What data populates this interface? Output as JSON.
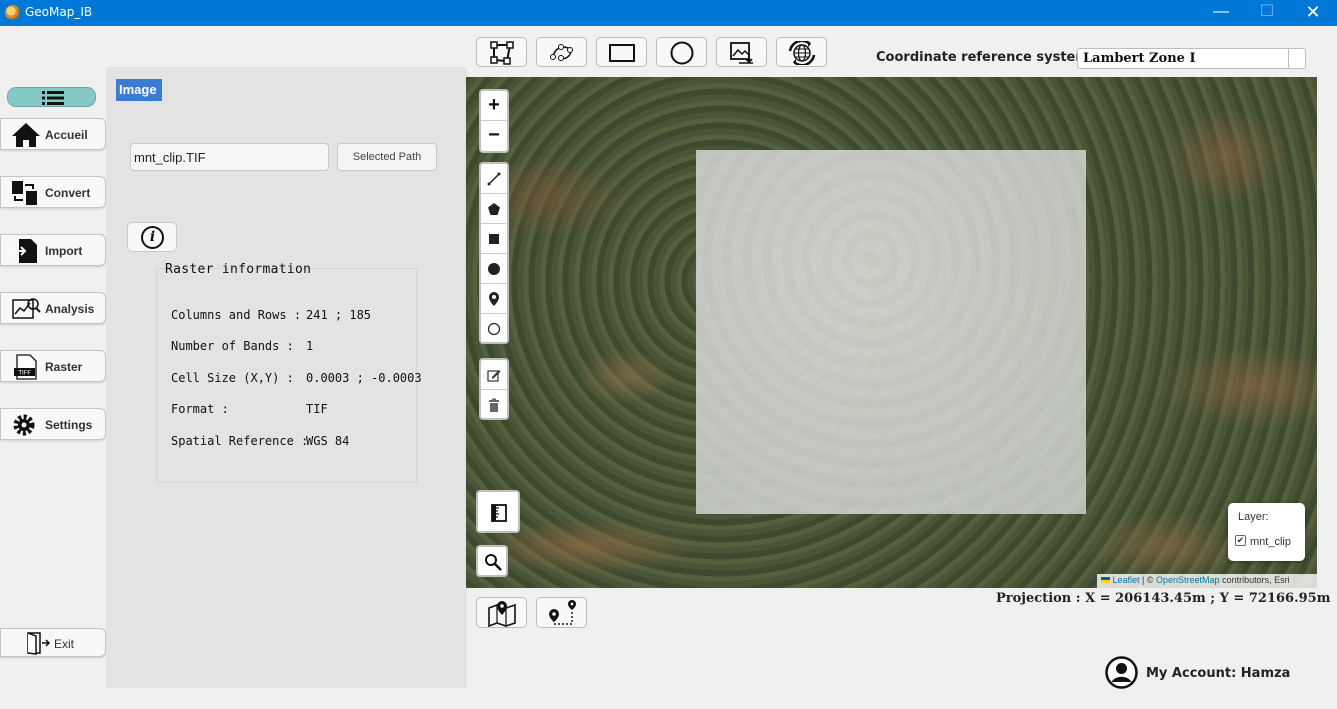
{
  "window": {
    "title": "GeoMap_IB",
    "minimize": "—",
    "maximize": "☐",
    "close": "✕"
  },
  "sidebar": {
    "items": [
      {
        "label": "Accueil",
        "icon": "home-icon"
      },
      {
        "label": "Convert",
        "icon": "convert-icon"
      },
      {
        "label": "Import",
        "icon": "import-icon"
      },
      {
        "label": "Analysis",
        "icon": "analysis-icon"
      },
      {
        "label": "Raster",
        "icon": "tiff-icon"
      },
      {
        "label": "Settings",
        "icon": "gear-icon"
      }
    ],
    "exit_label": "Exit"
  },
  "panel": {
    "title": "Image",
    "file_value": "mnt_clip.TIF",
    "path_button": "Selected Path",
    "raster_title": "Raster information",
    "rows": [
      {
        "key": "Columns and Rows :",
        "value": "241 ; 185"
      },
      {
        "key": "Number of Bands   :",
        "value": "1"
      },
      {
        "key": "Cell Size (X,Y)     :",
        "value": "0.0003 ; -0.0003"
      },
      {
        "key": "Format              :",
        "value": "TIF"
      },
      {
        "key": "Spatial Reference :",
        "value": "WGS 84"
      }
    ]
  },
  "toolbar": {
    "crs_label": "Coordinate reference system :",
    "crs_value": "Lambert Zone I"
  },
  "map": {
    "zoom_in": "+",
    "zoom_out": "−",
    "layers_title": "Layer:",
    "layer_name": "mnt_clip",
    "layer_checked": true,
    "attribution_leaflet": "Leaflet",
    "attribution_sep": " | © ",
    "attribution_osm": "OpenStreetMap",
    "attribution_rest": " contributors, Esri"
  },
  "status": {
    "projection": "Projection : X = 206143.45m ; Y = 72166.95m",
    "account": "My Account: Hamza"
  },
  "colors": {
    "titlebar": "#0078d7",
    "panel_title_bg": "#3a7bd5",
    "menu_toggle": "#85c9c6"
  }
}
